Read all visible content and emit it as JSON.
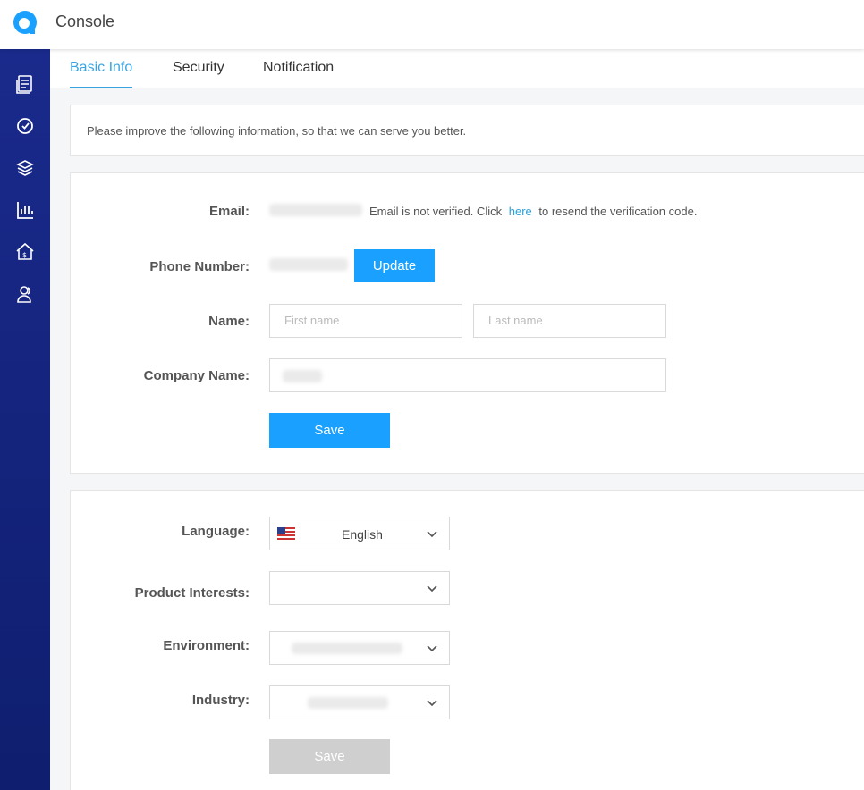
{
  "app": {
    "title": "Console"
  },
  "sidebar": {
    "items": [
      {
        "icon": "documents-icon"
      },
      {
        "icon": "target-icon"
      },
      {
        "icon": "layers-icon"
      },
      {
        "icon": "bar-chart-icon"
      },
      {
        "icon": "home-dollar-icon"
      },
      {
        "icon": "users-icon"
      }
    ]
  },
  "tabs": [
    {
      "label": "Basic Info",
      "active": true
    },
    {
      "label": "Security",
      "active": false
    },
    {
      "label": "Notification",
      "active": false
    }
  ],
  "notice": {
    "text": "Please improve the following information, so that we can serve you better."
  },
  "profile": {
    "email_label": "Email:",
    "email_status_prefix": "Email is not verified. Click",
    "email_link": "here",
    "email_status_suffix": "to resend the verification code.",
    "phone_label": "Phone Number:",
    "update_button": "Update",
    "name_label": "Name:",
    "first_name_placeholder": "First name",
    "last_name_placeholder": "Last name",
    "company_label": "Company Name:",
    "save_button": "Save"
  },
  "preferences": {
    "language_label": "Language:",
    "language_value": "English",
    "product_label": "Product Interests:",
    "environment_label": "Environment:",
    "industry_label": "Industry:",
    "save_button": "Save"
  },
  "colors": {
    "accent": "#1aa1ff",
    "sidebar": "#14237c",
    "tab_active": "#3aa4e0"
  }
}
